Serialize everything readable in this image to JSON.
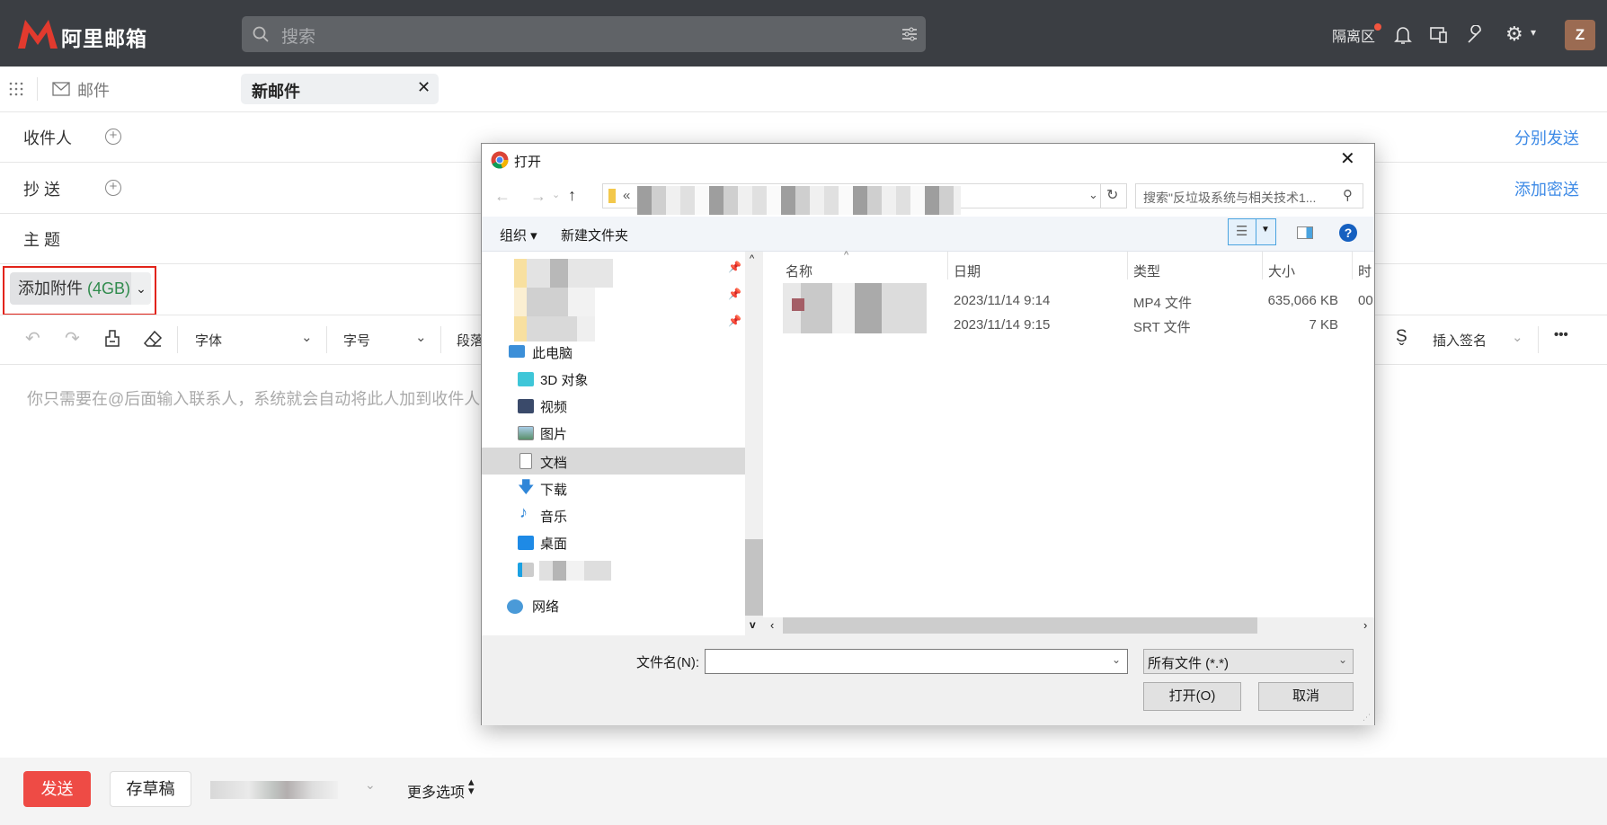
{
  "header": {
    "logo_text": "阿里邮箱",
    "search_placeholder": "搜索",
    "quarantine": "隔离区",
    "avatar": "Z"
  },
  "tabs": {
    "mail": "邮件",
    "new_mail": "新邮件"
  },
  "compose": {
    "to_label": "收件人",
    "cc_label": "抄 送",
    "subject_label": "主 题",
    "separate_send": "分别发送",
    "add_bcc": "添加密送",
    "attach_label": "添加附件",
    "attach_quota": "(4GB)",
    "body_placeholder": "你只需要在@后面输入联系人，系统就会自动将此人加到收件人中"
  },
  "toolbar": {
    "font": "字体",
    "size": "字号",
    "paragraph": "段落",
    "signature": "插入签名"
  },
  "footer": {
    "send": "发送",
    "save_draft": "存草稿",
    "more_options": "更多选项"
  },
  "dialog": {
    "title": "打开",
    "address_prefix": "«",
    "search_placeholder": "搜索\"反垃圾系统与相关技术1...",
    "organize": "组织 ▾",
    "new_folder": "新建文件夹",
    "nav": [
      {
        "label": "此电脑",
        "icon": "computer-icon"
      },
      {
        "label": "3D 对象",
        "icon": "cube-icon"
      },
      {
        "label": "视频",
        "icon": "video-icon"
      },
      {
        "label": "图片",
        "icon": "picture-icon"
      },
      {
        "label": "文档",
        "icon": "document-icon",
        "selected": true
      },
      {
        "label": "下载",
        "icon": "download-icon"
      },
      {
        "label": "音乐",
        "icon": "music-icon"
      },
      {
        "label": "桌面",
        "icon": "desktop-icon"
      },
      {
        "label": "网络",
        "icon": "network-icon"
      }
    ],
    "columns": [
      "名称",
      "日期",
      "类型",
      "大小",
      "时"
    ],
    "files": [
      {
        "date": "2023/11/14 9:14",
        "type": "MP4 文件",
        "size": "635,066 KB",
        "extra": "00"
      },
      {
        "date": "2023/11/14 9:15",
        "type": "SRT 文件",
        "size": "7 KB",
        "extra": ""
      }
    ],
    "filename_label": "文件名(N):",
    "filename_value": "",
    "filter": "所有文件 (*.*)",
    "open": "打开(O)",
    "cancel": "取消"
  }
}
